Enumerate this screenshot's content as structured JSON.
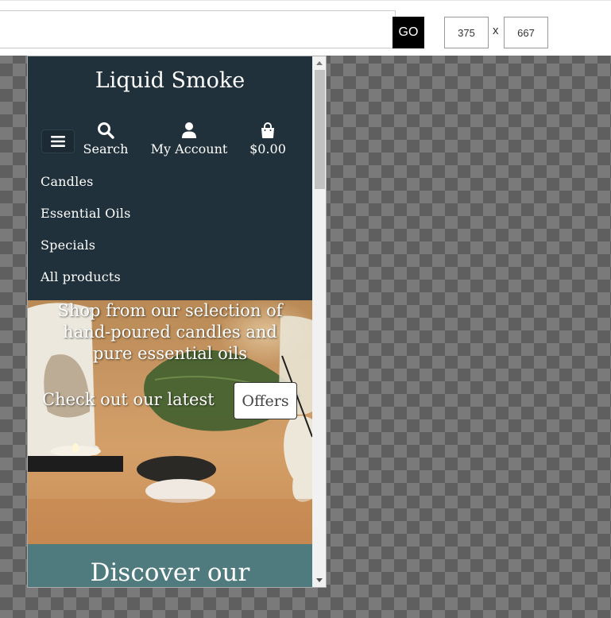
{
  "tester": {
    "url_value": "",
    "go_label": "GO",
    "width_value": "375",
    "separator": "x",
    "height_value": "667"
  },
  "site": {
    "brand": "Liquid Smoke",
    "nav_icons": [
      {
        "label": "Search",
        "icon": "search-icon"
      },
      {
        "label": "My Account",
        "icon": "user-icon"
      },
      {
        "label": "$0.00",
        "icon": "shopping-bag-icon"
      }
    ],
    "menu": [
      "Candles",
      "Essential Oils",
      "Specials",
      "All products"
    ],
    "hero": {
      "line1": "Shop from our selection of",
      "line2": "hand-poured candles and",
      "line3": "pure essential oils",
      "cta_text": "Check out our latest",
      "cta_button": "Offers"
    },
    "discover_title": "Discover our",
    "colors": {
      "header_bg": "#21313b",
      "discover_bg": "#4f7b7e",
      "go_bg": "#000000"
    }
  }
}
